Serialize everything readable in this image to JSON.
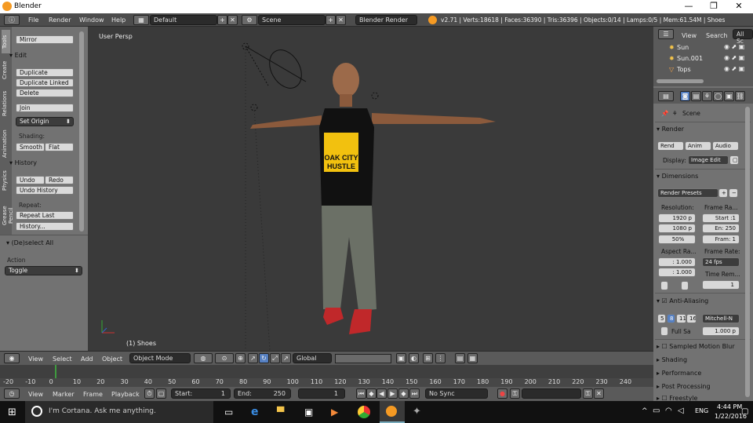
{
  "window": {
    "title": "Blender",
    "minimize": "—",
    "maximize": "❐",
    "close": "✕"
  },
  "menubar": {
    "file": "File",
    "render": "Render",
    "window": "Window",
    "help": "Help",
    "layout": "Default",
    "scene": "Scene",
    "engine": "Blender Render",
    "stats": "v2.71 | Verts:18618 | Faces:36390 | Tris:36396 | Objects:0/14 | Lamps:0/5 | Mem:61.54M | Shoes"
  },
  "toolshelf": {
    "tabs": [
      "Tools",
      "Create",
      "Relations",
      "Animation",
      "Physics",
      "Grease Pencil"
    ],
    "mirror": "Mirror",
    "edit_header": "Edit",
    "duplicate": "Duplicate",
    "duplicate_linked": "Duplicate Linked",
    "delete": "Delete",
    "join": "Join",
    "set_origin": "Set Origin",
    "shading_label": "Shading:",
    "smooth": "Smooth",
    "flat": "Flat",
    "history_header": "History",
    "undo": "Undo",
    "redo": "Redo",
    "undo_history": "Undo History",
    "repeat_label": "Repeat:",
    "repeat_last": "Repeat Last",
    "history_btn": "History...",
    "deselect_header": "(De)select All",
    "action_label": "Action",
    "action_value": "Toggle"
  },
  "viewport": {
    "view_name": "User Persp",
    "object_name": "(1) Shoes",
    "shirt_text1": "OAK CITY",
    "shirt_text2": "HUSTLE"
  },
  "view3d_header": {
    "view": "View",
    "select": "Select",
    "add": "Add",
    "object": "Object",
    "mode": "Object Mode",
    "orientation": "Global"
  },
  "timeline": {
    "ticks": [
      "-20",
      "-10",
      "0",
      "10",
      "20",
      "30",
      "40",
      "50",
      "60",
      "70",
      "80",
      "90",
      "100",
      "110",
      "120",
      "130",
      "140",
      "150",
      "160",
      "170",
      "180",
      "190",
      "200",
      "210",
      "220",
      "230",
      "240"
    ],
    "view": "View",
    "marker": "Marker",
    "frame": "Frame",
    "playback": "Playback",
    "start": "Start:",
    "start_val": "1",
    "end": "End:",
    "end_val": "250",
    "current": "1",
    "sync": "No Sync"
  },
  "outliner": {
    "view": "View",
    "search": "Search",
    "all_scenes": "All Sc",
    "items": [
      "Sun",
      "Sun.001",
      "Tops"
    ]
  },
  "properties": {
    "scene": "Scene",
    "render_header": "Render",
    "render_btn": "Rend",
    "anim_btn": "Anim",
    "audio_btn": "Audio",
    "display_label": "Display:",
    "display_value": "Image Edit",
    "dimensions_header": "Dimensions",
    "render_presets": "Render Presets",
    "resolution_label": "Resolution:",
    "res_x": "1920 p",
    "res_y": "1080 p",
    "res_pct": "50%",
    "frame_range_label": "Frame Ra...",
    "start": "Start :1",
    "end": "En: 250",
    "frame": "Fram: 1",
    "aspect_label": "Aspect Ra...",
    "aspect_x": ": 1.000",
    "aspect_y": ": 1.000",
    "frame_rate_label": "Frame Rate:",
    "fps": "24 fps",
    "time_remap_label": "Time Rem...",
    "remap_val": "1",
    "aa_header": "Anti-Aliasing",
    "aa_5": "5",
    "aa_8": "8",
    "aa_11": "11",
    "aa_16": "16",
    "aa_filter": "Mitchell-N",
    "full_sample": "Full Sa",
    "filter_size": "1.000 p",
    "sampled_motion_blur": "Sampled Motion Blur",
    "shading": "Shading",
    "performance": "Performance",
    "post_processing": "Post Processing",
    "freestyle": "Freestyle"
  },
  "taskbar": {
    "search": "I'm Cortana. Ask me anything.",
    "time": "4:44 PM",
    "date": "1/22/2016",
    "lang": "ENG"
  },
  "colors": {
    "accent": "#5680c2",
    "shirt_yellow": "#f2c10f",
    "active_tab": "#5680c2"
  }
}
